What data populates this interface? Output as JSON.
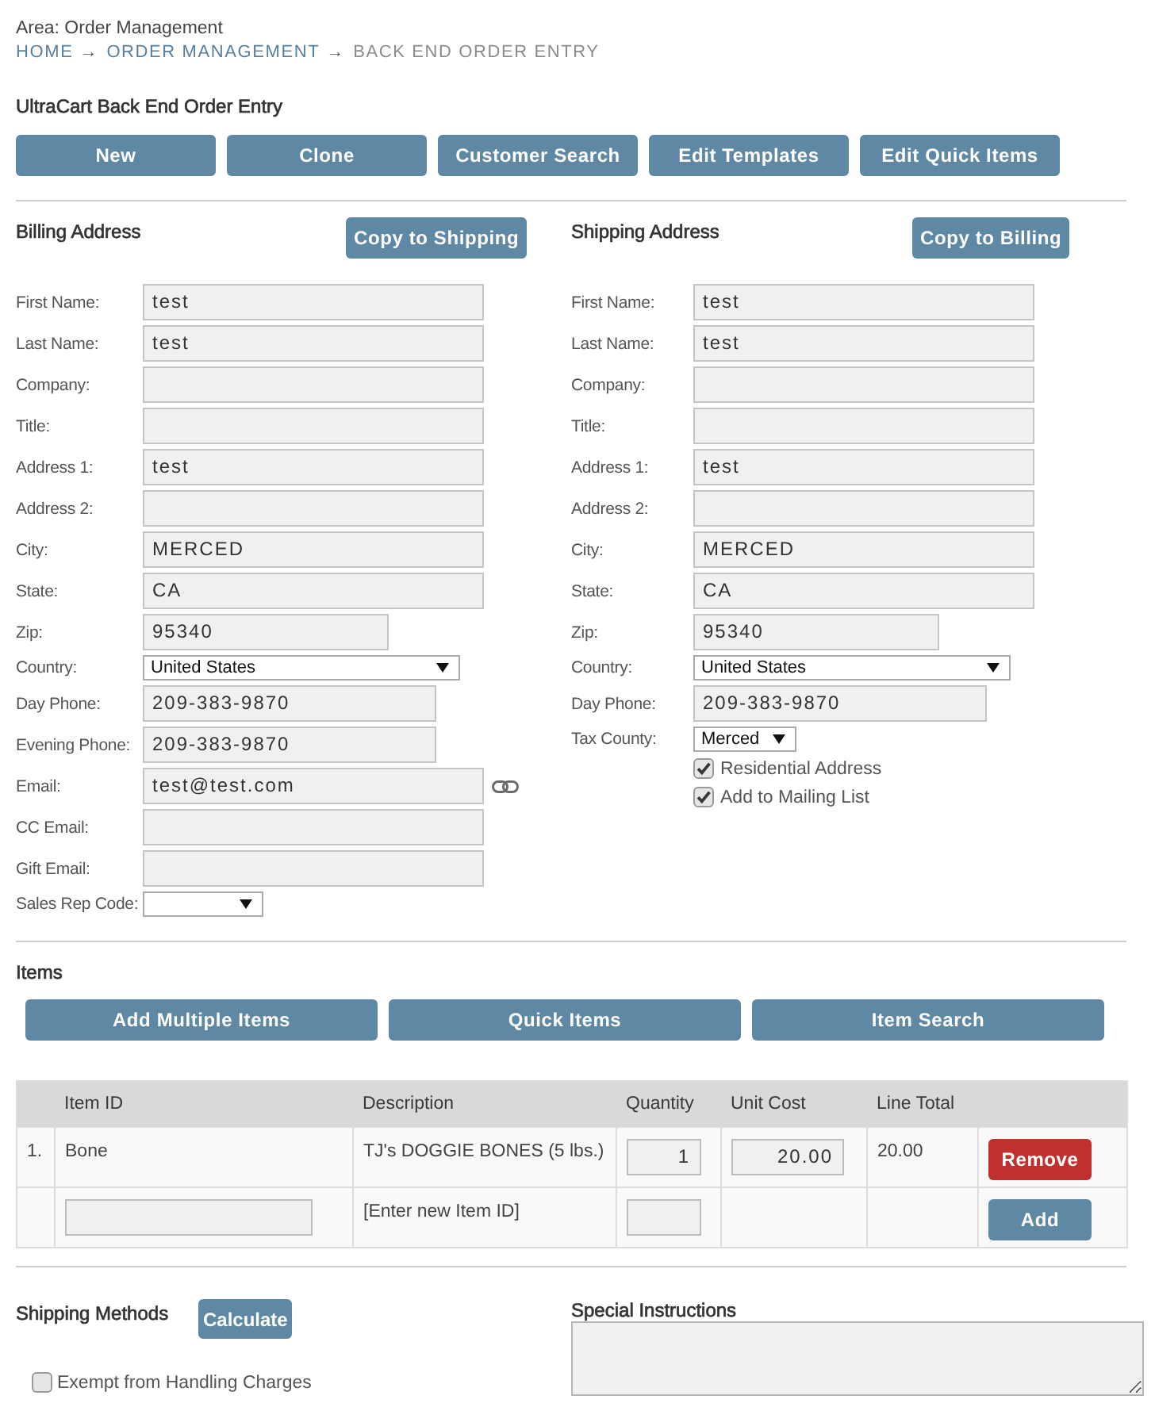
{
  "area_label": "Area: Order Management",
  "breadcrumb": [
    {
      "label": "HOME",
      "current": false,
      "separator": "→"
    },
    {
      "label": "ORDER MANAGEMENT",
      "current": false,
      "separator": "→"
    },
    {
      "label": "BACK END ORDER ENTRY",
      "current": true
    }
  ],
  "page_title": "UltraCart Back End Order Entry",
  "toolbar": [
    {
      "label": "New"
    },
    {
      "label": "Clone"
    },
    {
      "label": "Customer Search"
    },
    {
      "label": "Edit Templates"
    },
    {
      "label": "Edit Quick Items"
    }
  ],
  "billing_address": {
    "title": "Billing Address",
    "copy_button": "Copy to Shipping",
    "fields": [
      {
        "label": "First Name:",
        "kind": "text",
        "value": "test"
      },
      {
        "label": "Last Name:",
        "kind": "text",
        "value": "test"
      },
      {
        "label": "Company:",
        "kind": "text"
      },
      {
        "label": "Title:",
        "kind": "text"
      },
      {
        "label": "Address 1:",
        "kind": "text",
        "value": "test"
      },
      {
        "label": "Address 2:",
        "kind": "text"
      },
      {
        "label": "City:",
        "kind": "text",
        "value": "MERCED"
      },
      {
        "label": "State:",
        "kind": "text",
        "value": "CA"
      },
      {
        "label": "Zip:",
        "kind": "zip",
        "value": "95340"
      },
      {
        "label": "Country:",
        "kind": "dropdown-wide",
        "value": "United States"
      },
      {
        "label": "Day Phone:",
        "kind": "phone",
        "value": "209-383-9870"
      },
      {
        "label": "Evening Phone:",
        "kind": "phone",
        "value": "209-383-9870"
      },
      {
        "label": "Email:",
        "kind": "email",
        "value": "test@test.com"
      },
      {
        "label": "CC Email:",
        "kind": "text"
      },
      {
        "label": "Gift Email:",
        "kind": "text"
      },
      {
        "label": "Sales Rep Code:",
        "kind": "dropdown"
      }
    ]
  },
  "shipping_address": {
    "title": "Shipping Address",
    "copy_button": "Copy to Billing",
    "fields": [
      {
        "label": "First Name:",
        "kind": "text",
        "value": "test"
      },
      {
        "label": "Last Name:",
        "kind": "text",
        "value": "test"
      },
      {
        "label": "Company:",
        "kind": "text"
      },
      {
        "label": "Title:",
        "kind": "text"
      },
      {
        "label": "Address 1:",
        "kind": "text",
        "value": "test"
      },
      {
        "label": "Address 2:",
        "kind": "text"
      },
      {
        "label": "City:",
        "kind": "text",
        "value": "MERCED"
      },
      {
        "label": "State:",
        "kind": "text",
        "value": "CA"
      },
      {
        "label": "Zip:",
        "kind": "zip",
        "value": "95340"
      },
      {
        "label": "Country:",
        "kind": "dropdown-wide",
        "value": "United States"
      },
      {
        "label": "Day Phone:",
        "kind": "phone",
        "value": "209-383-9870"
      },
      {
        "label": "Tax County:",
        "kind": "dropdown",
        "value": "Merced"
      },
      {
        "label": "Residential Address",
        "kind": "checkbox",
        "checked": true
      },
      {
        "label": "Add to Mailing List",
        "kind": "checkbox",
        "checked": true
      }
    ]
  },
  "items": {
    "title": "Items",
    "buttons": [
      "Add Multiple Items",
      "Quick Items",
      "Item Search"
    ],
    "table": {
      "columns": [
        "Item ID",
        "Description",
        "Quantity",
        "Unit Cost",
        "Line Total"
      ],
      "rows": [
        {
          "kind": "item",
          "number": "1.",
          "item_id": "Bone",
          "description": "TJ's DOGGIE BONES (5 lbs.)",
          "quantity": "1",
          "unit_cost": "20.00",
          "line_total": "20.00",
          "action": "Remove"
        },
        {
          "kind": "new",
          "description": "[Enter new Item ID]",
          "action": "Add"
        }
      ]
    }
  },
  "shipping_methods": {
    "title": "Shipping Methods",
    "calculate_button": "Calculate",
    "exempt_handling": {
      "label": "Exempt from Handling Charges",
      "checked": false
    }
  },
  "special_instructions": {
    "label": "Special Instructions"
  }
}
